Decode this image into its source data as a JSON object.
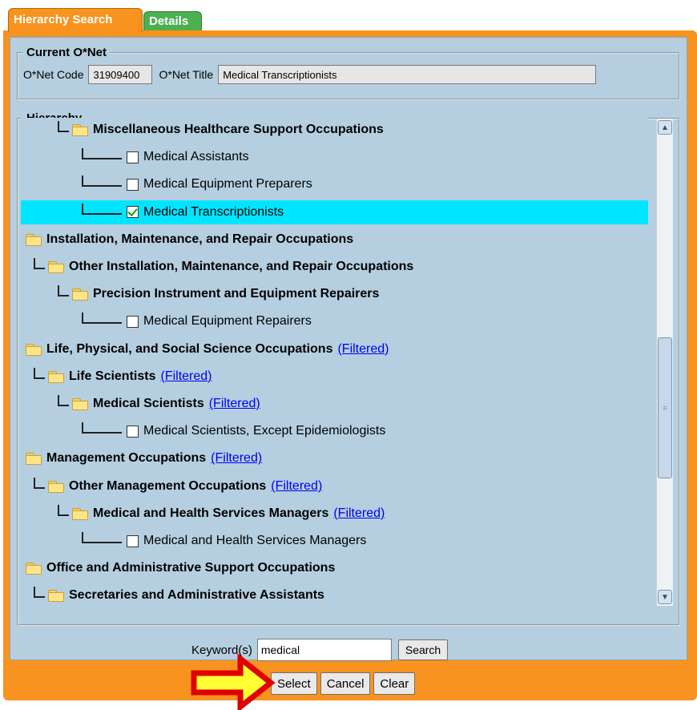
{
  "tabs": [
    {
      "label": "Hierarchy Search",
      "active": true
    },
    {
      "label": "Details",
      "active": false
    }
  ],
  "current": {
    "legend": "Current O*Net",
    "code_label": "O*Net Code",
    "code_value": "31909400",
    "title_label": "O*Net Title",
    "title_value": "Medical Transcriptionists"
  },
  "hierarchy": {
    "legend": "Hierarchy",
    "rows": [
      {
        "level": 1,
        "type": "category",
        "label": "Miscellaneous Healthcare Support Occupations"
      },
      {
        "level": 2,
        "type": "occupation",
        "label": "Medical Assistants",
        "checked": false
      },
      {
        "level": 2,
        "type": "occupation",
        "label": "Medical Equipment Preparers",
        "checked": false
      },
      {
        "level": 2,
        "type": "occupation",
        "label": "Medical Transcriptionists",
        "checked": true,
        "selected": true
      },
      {
        "level": -1,
        "type": "category",
        "label": "Installation, Maintenance, and Repair Occupations"
      },
      {
        "level": 0,
        "type": "category",
        "label": "Other Installation, Maintenance, and Repair Occupations"
      },
      {
        "level": 1,
        "type": "category",
        "label": "Precision Instrument and Equipment Repairers"
      },
      {
        "level": 2,
        "type": "occupation",
        "label": "Medical Equipment Repairers",
        "checked": false
      },
      {
        "level": -1,
        "type": "category",
        "label": "Life, Physical, and Social Science Occupations",
        "filtered": "(Filtered)"
      },
      {
        "level": 0,
        "type": "category",
        "label": "Life Scientists",
        "filtered": "(Filtered)"
      },
      {
        "level": 1,
        "type": "category",
        "label": "Medical Scientists",
        "filtered": "(Filtered)"
      },
      {
        "level": 2,
        "type": "occupation",
        "label": "Medical Scientists, Except Epidemiologists",
        "checked": false
      },
      {
        "level": -1,
        "type": "category",
        "label": "Management Occupations",
        "filtered": "(Filtered)"
      },
      {
        "level": 0,
        "type": "category",
        "label": "Other Management Occupations",
        "filtered": "(Filtered)"
      },
      {
        "level": 1,
        "type": "category",
        "label": "Medical and Health Services Managers",
        "filtered": "(Filtered)"
      },
      {
        "level": 2,
        "type": "occupation",
        "label": "Medical and Health Services Managers",
        "checked": false
      },
      {
        "level": -1,
        "type": "category",
        "label": "Office and Administrative Support Occupations"
      },
      {
        "level": 0,
        "type": "category",
        "label": "Secretaries and Administrative Assistants"
      }
    ]
  },
  "search": {
    "keyword_label": "Keyword(s)",
    "keyword_value": "medical",
    "search_label": "Search"
  },
  "footer": {
    "select_label": "Select",
    "cancel_label": "Cancel",
    "clear_label": "Clear"
  },
  "icons": {
    "scroll_up": "scroll-up-icon",
    "scroll_down": "scroll-down-icon",
    "folder": "folder-icon",
    "arrow": "red-arrow-icon"
  },
  "colors": {
    "accent": "#f7931e",
    "panel": "#b5cfe0",
    "selected_row": "#00e5ff",
    "arrow_fill": "#ffff33",
    "arrow_stroke": "#e00000"
  }
}
